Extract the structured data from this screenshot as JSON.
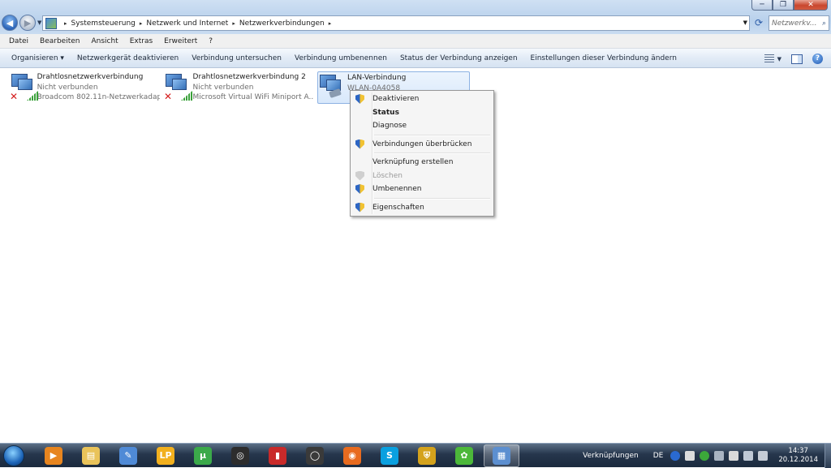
{
  "window": {
    "caption_buttons": {
      "minimize": "─",
      "maximize": "❐",
      "close": "✕"
    }
  },
  "address": {
    "breadcrumbs": [
      "Systemsteuerung",
      "Netzwerk und Internet",
      "Netzwerkverbindungen"
    ],
    "search_placeholder": "Netzwerkv...",
    "search_icon": "search-icon",
    "refresh_icon": "refresh-icon"
  },
  "menubar": {
    "items": [
      "Datei",
      "Bearbeiten",
      "Ansicht",
      "Extras",
      "Erweitert",
      "?"
    ]
  },
  "commandbar": {
    "organize": "Organisieren ▾",
    "items": [
      "Netzwerkgerät deaktivieren",
      "Verbindung untersuchen",
      "Verbindung umbenennen",
      "Status der Verbindung anzeigen",
      "Einstellungen dieser Verbindung ändern"
    ],
    "help": "?"
  },
  "connections": [
    {
      "name": "Drahtlosnetzwerkverbindung",
      "status": "Nicht verbunden",
      "device": "Broadcom 802.11n-Netzwerkadap...",
      "icon": "wireless-disconnected-icon"
    },
    {
      "name": "Drahtlosnetzwerkverbindung 2",
      "status": "Nicht verbunden",
      "device": "Microsoft Virtual WiFi Miniport A...",
      "icon": "wireless-disconnected-icon"
    },
    {
      "name": "LAN-Verbindung",
      "status": "WLAN-0A4058",
      "device": "",
      "icon": "lan-icon",
      "selected": true
    }
  ],
  "context_menu": {
    "items": [
      {
        "label": "Deaktivieren",
        "shield": true
      },
      {
        "label": "Status",
        "bold": true
      },
      {
        "label": "Diagnose"
      },
      {
        "label": "Verbindungen überbrücken",
        "shield": true
      },
      {
        "label": "Verknüpfung erstellen"
      },
      {
        "label": "Löschen",
        "shield": true,
        "disabled": true
      },
      {
        "label": "Umbenennen",
        "shield": true
      },
      {
        "label": "Eigenschaften",
        "shield": true
      }
    ]
  },
  "taskbar": {
    "apps": [
      {
        "icon": "media-player-icon",
        "glyph": "▶",
        "color": "#e7851f"
      },
      {
        "icon": "file-explorer-icon",
        "glyph": "▤",
        "color": "#e9c35a"
      },
      {
        "icon": "paint-icon",
        "glyph": "✎",
        "color": "#4f8ad6"
      },
      {
        "icon": "lp-app-icon",
        "glyph": "LP",
        "color": "#f2b01e"
      },
      {
        "icon": "utorrent-icon",
        "glyph": "µ",
        "color": "#3ba94a"
      },
      {
        "icon": "app-spiral-icon",
        "glyph": "◎",
        "color": "#2d2d2d"
      },
      {
        "icon": "book-icon",
        "glyph": "▮",
        "color": "#c92a2a"
      },
      {
        "icon": "search-tool-icon",
        "glyph": "◯",
        "color": "#3a3a3a"
      },
      {
        "icon": "firefox-icon",
        "glyph": "◉",
        "color": "#e86b1f"
      },
      {
        "icon": "skype-icon",
        "glyph": "S",
        "color": "#0aa0e0"
      },
      {
        "icon": "security-shield-icon",
        "glyph": "⛨",
        "color": "#d4a21c"
      },
      {
        "icon": "icq-icon",
        "glyph": "✿",
        "color": "#4cb83a"
      },
      {
        "icon": "network-connections-icon",
        "glyph": "▦",
        "color": "#5c8fd0",
        "active": true
      }
    ],
    "links_label": "Verknüpfungen",
    "lang": "DE",
    "time": "14:37",
    "date": "20.12.2014"
  }
}
